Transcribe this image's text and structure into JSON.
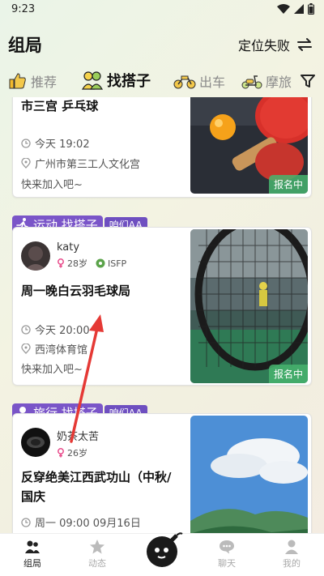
{
  "status_bar": {
    "time": "9:23"
  },
  "header": {
    "title": "组局",
    "location_label": "定位失败"
  },
  "tabs": [
    {
      "label": "推荐",
      "icon": "thumbs-up-icon",
      "active": false
    },
    {
      "label": "找搭子",
      "icon": "people-icon",
      "active": true
    },
    {
      "label": "出车",
      "icon": "motorcycle-icon",
      "active": false
    },
    {
      "label": "摩旅",
      "icon": "scooter-icon",
      "active": false
    }
  ],
  "cards": [
    {
      "title": "市三宫 乒乓球",
      "time": "今天 19:02",
      "place": "广州市第三工人文化宫",
      "join": "快来加入吧~",
      "status": "报名中"
    },
    {
      "category": "运动.找搭子",
      "cost_tag": "咱们AA",
      "user": {
        "name": "katy",
        "age": "28岁",
        "mbti": "ISFP"
      },
      "title": "周一晚白云羽毛球局",
      "time": "今天 20:00",
      "place": "西湾体育馆",
      "join": "快来加入吧~",
      "status": "报名中"
    },
    {
      "category": "旅行.找搭子",
      "cost_tag": "咱们AA",
      "user": {
        "name": "奶茶太苦",
        "age": "26岁"
      },
      "title": "反穿绝美江西武功山（中秋/国庆",
      "time": "周一 09:00 09月16日"
    }
  ],
  "bottom_nav": [
    {
      "label": "组局",
      "icon": "group-icon",
      "active": true
    },
    {
      "label": "动态",
      "icon": "star-icon",
      "active": false
    },
    {
      "label": "",
      "icon": "bomb-icon",
      "active": false
    },
    {
      "label": "聊天",
      "icon": "chat-icon",
      "active": false
    },
    {
      "label": "我的",
      "icon": "profile-icon",
      "active": false
    }
  ],
  "colors": {
    "accent_purple": "#7a55c8",
    "status_green": "#46b46e",
    "arrow_red": "#e53935"
  }
}
